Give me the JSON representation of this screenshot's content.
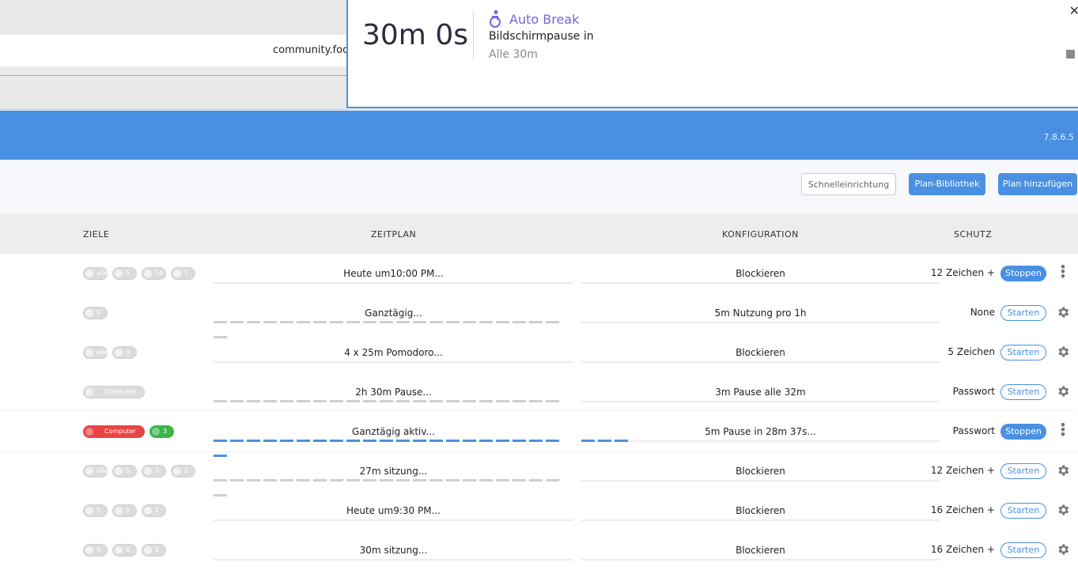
{
  "browser": {
    "url_fragment": "community.foc"
  },
  "popup": {
    "timer": "30m 0s",
    "title": "Auto Break",
    "subtitle": "Bildschirmpause in",
    "interval": "Alle 30m",
    "close_glyph": "✕",
    "accent": "#7b62d9"
  },
  "header": {
    "version": "7.8.6.5",
    "color": "#4a90e2"
  },
  "toolbar": {
    "quick_setup": "Schnelleinrichtung",
    "library": "Plan-Bibliothek",
    "add_plan": "Plan hinzufügen"
  },
  "columns": {
    "targets": "ZIELE",
    "schedule": "ZEITPLAN",
    "config": "KONFIGURATION",
    "protection": "SCHUTZ"
  },
  "rows": [
    {
      "targets": [
        {
          "t": "alle",
          "c": "gray"
        },
        {
          "t": "5",
          "c": "gray"
        },
        {
          "t": "14",
          "c": "gray"
        },
        {
          "t": "1",
          "c": "gray"
        }
      ],
      "schedule": "Heute um10:00 PM...",
      "config": "Blockieren",
      "protection": "12 Zeichen +",
      "action": "Stoppen",
      "action_type": "stop",
      "menu": "dots",
      "segments": 0,
      "conf_segments": 0
    },
    {
      "targets": [
        {
          "t": "9",
          "c": "gray"
        }
      ],
      "schedule": "Ganztägig...",
      "config": "5m Nutzung pro 1h",
      "protection": "None",
      "action": "Starten",
      "action_type": "start",
      "menu": "gear",
      "segments": 22,
      "conf_segments": 0
    },
    {
      "targets": [
        {
          "t": "alle",
          "c": "gray"
        },
        {
          "t": "3",
          "c": "gray"
        }
      ],
      "schedule": "4 x 25m Pomodoro...",
      "config": "Blockieren",
      "protection": "5 Zeichen",
      "action": "Starten",
      "action_type": "start",
      "menu": "gear",
      "segments": 0,
      "conf_segments": 0
    },
    {
      "targets": [
        {
          "t": "Computer",
          "c": "gray",
          "wide": true
        }
      ],
      "schedule": "2h 30m Pause...",
      "config": "3m Pause alle 32m",
      "protection": "Passwort",
      "action": "Starten",
      "action_type": "start",
      "menu": "gear",
      "segments": 22,
      "conf_segments": 0
    },
    {
      "targets": [
        {
          "t": "Computer",
          "c": "red",
          "wide": true
        },
        {
          "t": "3",
          "c": "green"
        }
      ],
      "schedule": "Ganztägig aktiv...",
      "config": "5m Pause in 28m 37s...",
      "protection": "Passwort",
      "action": "Stoppen",
      "action_type": "stop",
      "menu": "dots",
      "segments": 22,
      "seg_color": "blue",
      "conf_segments": 3,
      "active": true
    },
    {
      "targets": [
        {
          "t": "alle",
          "c": "gray"
        },
        {
          "t": "5",
          "c": "gray"
        },
        {
          "t": "5",
          "c": "gray"
        },
        {
          "t": "1",
          "c": "gray"
        }
      ],
      "schedule": "27m sitzung...",
      "config": "Blockieren",
      "protection": "12 Zeichen +",
      "action": "Starten",
      "action_type": "start",
      "menu": "gear",
      "segments": 22,
      "conf_segments": 0
    },
    {
      "targets": [
        {
          "t": "5",
          "c": "gray"
        },
        {
          "t": "5",
          "c": "gray"
        },
        {
          "t": "1",
          "c": "gray"
        }
      ],
      "schedule": "Heute um9:30 PM...",
      "config": "Blockieren",
      "protection": "16 Zeichen +",
      "action": "Starten",
      "action_type": "start",
      "menu": "gear",
      "segments": 0,
      "conf_segments": 0
    },
    {
      "targets": [
        {
          "t": "5",
          "c": "gray"
        },
        {
          "t": "6",
          "c": "gray"
        },
        {
          "t": "1",
          "c": "gray"
        }
      ],
      "schedule": "30m sitzung...",
      "config": "Blockieren",
      "protection": "16 Zeichen +",
      "action": "Starten",
      "action_type": "start",
      "menu": "gear",
      "segments": 0,
      "conf_segments": 0
    }
  ]
}
